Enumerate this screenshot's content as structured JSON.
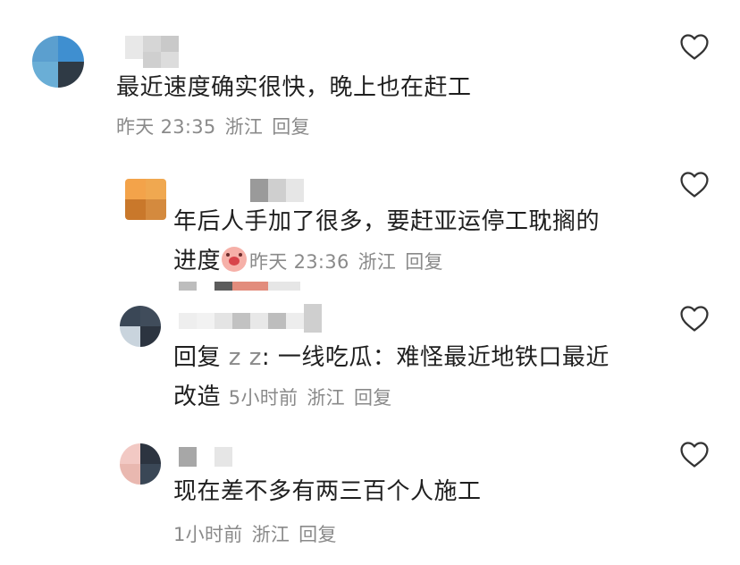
{
  "comments": [
    {
      "text": "最近速度确实很快，晚上也在赶工",
      "time": "昨天 23:35",
      "location": "浙江",
      "reply": "回复"
    },
    {
      "text_line1": "年后人手加了很多，要赶亚运停工耽搁的",
      "text_line2": "进度",
      "time": "昨天 23:36",
      "location": "浙江",
      "reply": "回复"
    },
    {
      "reply_prefix": "回复",
      "mention": "z z",
      "text_line1_rest": ": 一线吃瓜：难怪最近地铁口最近",
      "text_line2": "改造",
      "time": "5小时前",
      "location": "浙江",
      "reply": "回复"
    },
    {
      "text": "现在差不多有两三百个人施工",
      "time": "1小时前",
      "location": "浙江",
      "reply": "回复"
    }
  ],
  "icons": {
    "like": "heart-outline-icon",
    "emoji": "scared-face-emoji-icon"
  },
  "colors": {
    "text": "#1f1f1f",
    "meta": "#8a8a8a",
    "icon_stroke": "#333333"
  }
}
